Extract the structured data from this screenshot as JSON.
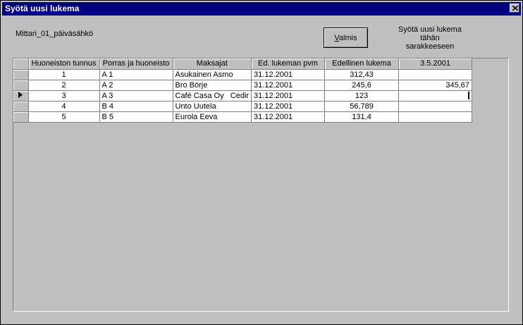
{
  "window": {
    "title": "Syötä uusi lukema"
  },
  "meter_label": "Mittari_01_päiväsähkö",
  "done_button": {
    "label_prefix": "",
    "label_accel": "V",
    "label_rest": "almis"
  },
  "hint": "Syötä uusi lukema\ntähän\nsarakkeeseen",
  "grid": {
    "headers": [
      "Huoneiston tunnus",
      "Porras ja huoneisto",
      "Maksajat",
      "Ed. lukeman pvm",
      "Edellinen lukema",
      "3.5.2001"
    ],
    "rows": [
      {
        "id": "1",
        "stair": "A 1",
        "payer": "Asukainen Asmo",
        "date": "31.12.2001",
        "prev": "312,43",
        "new": ""
      },
      {
        "id": "2",
        "stair": "A 2",
        "payer": "Bro Börje",
        "date": "31.12.2001",
        "prev": "245,6",
        "new": "345,67"
      },
      {
        "id": "3",
        "stair": "A 3",
        "payer": "Café Casa Oy   Cedir",
        "date": "31.12.2001",
        "prev": "123",
        "new": ""
      },
      {
        "id": "4",
        "stair": "B 4",
        "payer": "Unto Uutela",
        "date": "31.12.2001",
        "prev": "56,789",
        "new": ""
      },
      {
        "id": "5",
        "stair": "B 5",
        "payer": "Eurola Eeva",
        "date": "31.12.2001",
        "prev": "131,4",
        "new": ""
      }
    ],
    "current_row": 3
  }
}
